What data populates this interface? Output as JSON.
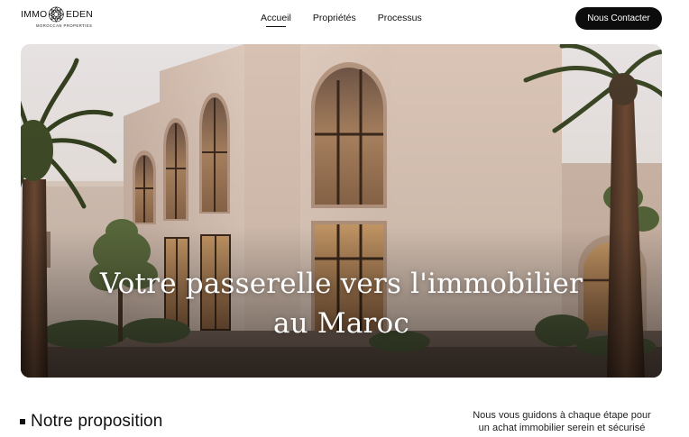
{
  "brand": {
    "word_left": "IMMO",
    "word_right": "EDEN",
    "tagline": "MOROCCAN PROPERTIES",
    "emblem_icon": "mandala-icon"
  },
  "nav": {
    "items": [
      {
        "label": "Accueil",
        "active": true
      },
      {
        "label": "Propriétés",
        "active": false
      },
      {
        "label": "Processus",
        "active": false
      }
    ]
  },
  "cta": {
    "label": "Nous Contacter"
  },
  "hero": {
    "title_line1": "Votre passerelle vers l'immobilier",
    "title_line2": "au Maroc"
  },
  "section": {
    "title": "Notre proposition",
    "tagline_line1": "Nous vous guidons à chaque étape pour",
    "tagline_line2": "un achat immobilier serein et sécurisé"
  },
  "colors": {
    "accent": "#0c0c0c",
    "wall": "#d8c3b4",
    "sky": "#ece3dc",
    "window_glow": "#b78e62"
  }
}
